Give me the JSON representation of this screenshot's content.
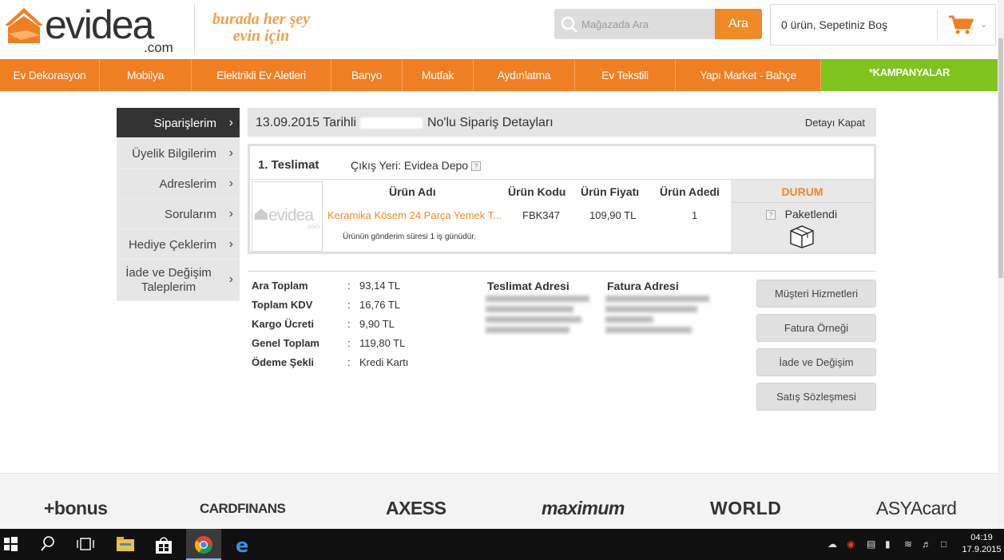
{
  "header": {
    "logo_text": "evidea",
    "logo_domain": ".com",
    "slogan_line1": "burada her şey",
    "slogan_line2": "evin için",
    "search_placeholder": "Mağazada Ara",
    "search_button": "Ara",
    "cart_text": "0 ürün, Sepetiniz Boş"
  },
  "nav": [
    "Ev Dekorasyon",
    "Mobilya",
    "Elektrikli Ev Aletleri",
    "Banyo",
    "Mutfak",
    "Aydınlatma",
    "Ev Tekstili",
    "Yapı Market - Bahçe",
    "*KAMPANYALAR"
  ],
  "sidebar": [
    "Siparişlerim",
    "Üyelik Bilgilerim",
    "Adreslerim",
    "Sorularım",
    "Hediye Çeklerim",
    "İade ve Değişim Taleplerim"
  ],
  "order": {
    "title_prefix": "13.09.2015 Tarihli",
    "title_suffix": "No'lu Sipariş Detayları",
    "close_label": "Detayı Kapat"
  },
  "delivery": {
    "title": "1. Teslimat",
    "origin": "Çıkış Yeri: Evidea Depo",
    "headers": {
      "name": "Ürün Adı",
      "code": "Ürün Kodu",
      "price": "Ürün Fiyatı",
      "qty": "Ürün Adedi",
      "status": "DURUM"
    },
    "product": {
      "name": "Keramika Kösem 24 Parça Yemek T...",
      "code": "FBK347",
      "price": "109,90 TL",
      "qty": "1",
      "status": "Paketlendi"
    },
    "ship_note": "Ürünün gönderim süresi 1 iş günüdür."
  },
  "totals": [
    {
      "label": "Ara Toplam",
      "value": "93,14 TL"
    },
    {
      "label": "Toplam KDV",
      "value": "16,76 TL"
    },
    {
      "label": "Kargo Ücreti",
      "value": "9,90 TL"
    },
    {
      "label": "Genel Toplam",
      "value": "119,80 TL"
    },
    {
      "label": "Ödeme Şekli",
      "value": "Kredi Kartı"
    }
  ],
  "addresses": {
    "shipping_title": "Teslimat Adresi",
    "billing_title": "Fatura Adresi"
  },
  "actions": [
    "Müşteri Hizmetleri",
    "Fatura Örneği",
    "İade ve Değişim",
    "Satış Sözleşmesi"
  ],
  "footer_brands": [
    "+bonus",
    "CARDFINANS",
    "AXESS",
    "maximum",
    "WORLD",
    "ASYAcard"
  ],
  "taskbar": {
    "time": "04:19",
    "date": "17.9.2015"
  },
  "colors": {
    "brand_orange": "#f07f24",
    "campaign_green": "#7fc41c"
  }
}
